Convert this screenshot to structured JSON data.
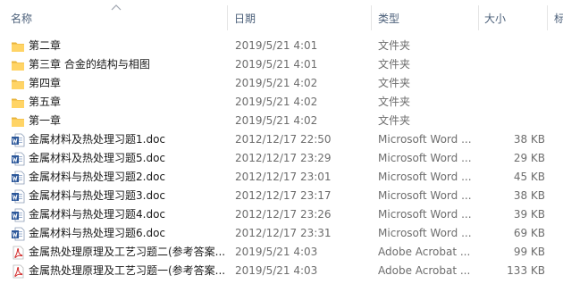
{
  "columns": {
    "name": "名称",
    "date": "日期",
    "type": "类型",
    "size": "大小",
    "extra": "标"
  },
  "rows": [
    {
      "name": "第二章",
      "date": "2019/5/21 4:01",
      "type": "文件夹",
      "size": "",
      "icon": "folder-icon"
    },
    {
      "name": "第三章 合金的结构与相图",
      "date": "2019/5/21 4:01",
      "type": "文件夹",
      "size": "",
      "icon": "folder-icon"
    },
    {
      "name": "第四章",
      "date": "2019/5/21 4:02",
      "type": "文件夹",
      "size": "",
      "icon": "folder-icon"
    },
    {
      "name": "第五章",
      "date": "2019/5/21 4:02",
      "type": "文件夹",
      "size": "",
      "icon": "folder-icon"
    },
    {
      "name": "第一章",
      "date": "2019/5/21 4:02",
      "type": "文件夹",
      "size": "",
      "icon": "folder-icon"
    },
    {
      "name": "金属材料及热处理习题1.doc",
      "date": "2012/12/17 22:50",
      "type": "Microsoft Word ...",
      "size": "38 KB",
      "icon": "word-doc-icon"
    },
    {
      "name": "金属材料及热处理习题5.doc",
      "date": "2012/12/17 23:29",
      "type": "Microsoft Word ...",
      "size": "29 KB",
      "icon": "word-doc-icon"
    },
    {
      "name": "金属材料与热处理习题2.doc",
      "date": "2012/12/17 23:01",
      "type": "Microsoft Word ...",
      "size": "45 KB",
      "icon": "word-doc-icon"
    },
    {
      "name": "金属材料与热处理习题3.doc",
      "date": "2012/12/17 23:17",
      "type": "Microsoft Word ...",
      "size": "38 KB",
      "icon": "word-doc-icon"
    },
    {
      "name": "金属材料与热处理习题4.doc",
      "date": "2012/12/17 23:26",
      "type": "Microsoft Word ...",
      "size": "39 KB",
      "icon": "word-doc-icon"
    },
    {
      "name": "金属材料与热处理习题6.doc",
      "date": "2012/12/17 23:31",
      "type": "Microsoft Word ...",
      "size": "69 KB",
      "icon": "word-doc-icon"
    },
    {
      "name": "金属热处理原理及工艺习题二(参考答案...",
      "date": "2019/5/21 4:03",
      "type": "Adobe Acrobat ...",
      "size": "99 KB",
      "icon": "pdf-icon"
    },
    {
      "name": "金属热处理原理及工艺习题一(参考答案...",
      "date": "2019/5/21 4:03",
      "type": "Adobe Acrobat ...",
      "size": "133 KB",
      "icon": "pdf-icon"
    }
  ]
}
